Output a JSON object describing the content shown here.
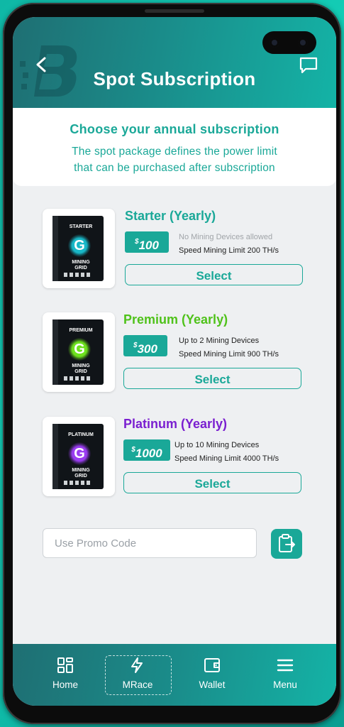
{
  "header": {
    "title": "Spot Subscription"
  },
  "intro": {
    "heading": "Choose your annual subscription",
    "line1": "The spot package defines the power limit",
    "line2": "that can be purchased after subscription"
  },
  "plans": [
    {
      "name": "Starter (Yearly)",
      "price_symbol": "$",
      "price": "100",
      "detail1": "No Mining Devices allowed",
      "detail2": "Speed Mining Limit 200 TH/s",
      "select_label": "Select",
      "box_label": "STARTER",
      "color": "#1aa898",
      "box_accent": "#18b8c8"
    },
    {
      "name": "Premium (Yearly)",
      "price_symbol": "$",
      "price": "300",
      "detail1": "Up to 2 Mining Devices",
      "detail2": "Speed Mining Limit 900 TH/s",
      "select_label": "Select",
      "box_label": "PREMIUM",
      "color": "#4fc21a",
      "box_accent": "#6ee21e"
    },
    {
      "name": "Platinum (Yearly)",
      "price_symbol": "$",
      "price": "1000",
      "detail1": "Up to 10 Mining Devices",
      "detail2": "Speed Mining Limit 4000 TH/s",
      "select_label": "Select",
      "box_label": "PLATINUM",
      "color": "#7a1fd0",
      "box_accent": "#9a3cf0"
    }
  ],
  "box_common": {
    "logo_letter": "G",
    "grid_line1": "MINING",
    "grid_line2": "GRID"
  },
  "promo": {
    "placeholder": "Use Promo Code"
  },
  "nav": {
    "items": [
      {
        "label": "Home",
        "icon": "grid-icon"
      },
      {
        "label": "MRace",
        "icon": "lightning-icon"
      },
      {
        "label": "Wallet",
        "icon": "wallet-icon"
      },
      {
        "label": "Menu",
        "icon": "menu-icon"
      }
    ],
    "active": "MRace"
  },
  "colors": {
    "accent": "#1aa898",
    "header_gradient_start": "#1f6f73",
    "header_gradient_end": "#14b3a6"
  }
}
